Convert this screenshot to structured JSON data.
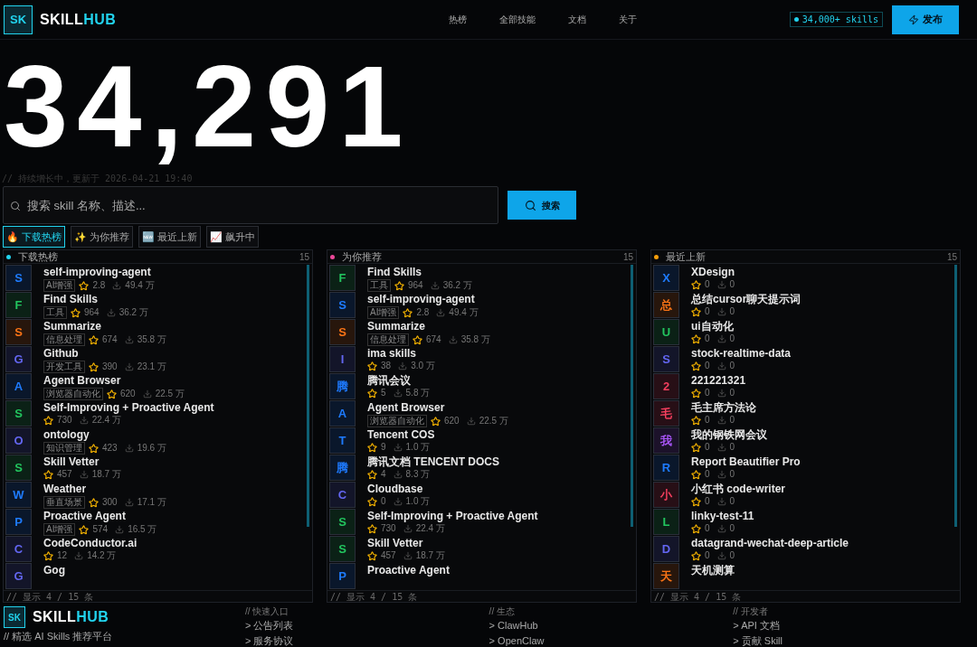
{
  "header": {
    "logo_mark": "SK",
    "logo_a": "SKILL",
    "logo_b": "HUB",
    "nav": [
      {
        "label": "热榜",
        "selected": false
      },
      {
        "label": "全部技能",
        "selected": false
      },
      {
        "label": "文档",
        "selected": false
      },
      {
        "label": "关于",
        "selected": false
      }
    ],
    "badge": "34,000+ skills",
    "publish": "发布"
  },
  "hero": {
    "number": "34,291",
    "subtitle": "// 持续增长中，更新于 2026-04-21 19:40"
  },
  "search": {
    "placeholder": "搜索 skill 名称、描述...",
    "button": "搜索"
  },
  "tabs": [
    {
      "icon": "🔥",
      "label": "下载热榜",
      "selected": true
    },
    {
      "icon": "✨",
      "label": "为你推荐",
      "selected": false
    },
    {
      "icon": "🆕",
      "label": "最近上新",
      "selected": false
    },
    {
      "icon": "📈",
      "label": "飙升中",
      "selected": false
    }
  ],
  "columns": [
    {
      "title": "下载热榜",
      "color": "#22d3ee",
      "count": "15",
      "footer": "// 显示 4 / 15 条",
      "items": [
        {
          "letter": "S",
          "color": "#1e7bff",
          "name": "self-improving-agent",
          "tag": "AI增强",
          "stars": "2.8",
          "downloads": "49.4 万"
        },
        {
          "letter": "F",
          "color": "#22c55e",
          "name": "Find Skills",
          "tag": "工具",
          "stars": "964",
          "downloads": "36.2 万"
        },
        {
          "letter": "S",
          "color": "#f97316",
          "name": "Summarize",
          "tag": "信息处理",
          "stars": "674",
          "downloads": "35.8 万"
        },
        {
          "letter": "G",
          "color": "#6366f1",
          "name": "Github",
          "tag": "开发工具",
          "stars": "390",
          "downloads": "23.1 万"
        },
        {
          "letter": "A",
          "color": "#1e7bff",
          "name": "Agent Browser",
          "tag": "浏览器自动化",
          "stars": "620",
          "downloads": "22.5 万"
        },
        {
          "letter": "S",
          "color": "#22c55e",
          "name": "Self-Improving + Proactive Agent",
          "stars": "730",
          "downloads": "22.4 万"
        },
        {
          "letter": "O",
          "color": "#6366f1",
          "name": "ontology",
          "tag": "知识管理",
          "stars": "423",
          "downloads": "19.6 万"
        },
        {
          "letter": "S",
          "color": "#22c55e",
          "name": "Skill Vetter",
          "stars": "457",
          "downloads": "18.7 万"
        },
        {
          "letter": "W",
          "color": "#1e7bff",
          "name": "Weather",
          "tag": "垂直场景",
          "stars": "300",
          "downloads": "17.1 万"
        },
        {
          "letter": "P",
          "color": "#1e7bff",
          "name": "Proactive Agent",
          "tag": "AI增强",
          "stars": "574",
          "downloads": "16.5 万"
        },
        {
          "letter": "C",
          "color": "#6366f1",
          "name": "CodeConductor.ai",
          "stars": "12",
          "downloads": "14.2 万"
        },
        {
          "letter": "G",
          "color": "#6366f1",
          "name": "Gog"
        }
      ]
    },
    {
      "title": "为你推荐",
      "color": "#ec4899",
      "count": "15",
      "footer": "// 显示 4 / 15 条",
      "items": [
        {
          "letter": "F",
          "color": "#22c55e",
          "name": "Find Skills",
          "tag": "工具",
          "stars": "964",
          "downloads": "36.2 万"
        },
        {
          "letter": "S",
          "color": "#1e7bff",
          "name": "self-improving-agent",
          "tag": "AI增强",
          "stars": "2.8",
          "downloads": "49.4 万"
        },
        {
          "letter": "S",
          "color": "#f97316",
          "name": "Summarize",
          "tag": "信息处理",
          "stars": "674",
          "downloads": "35.8 万"
        },
        {
          "letter": "I",
          "color": "#6366f1",
          "name": "ima skills",
          "stars": "38",
          "downloads": "3.0 万"
        },
        {
          "letter": "腾",
          "color": "#1e7bff",
          "name": "腾讯会议",
          "stars": "5",
          "downloads": "5.8 万"
        },
        {
          "letter": "A",
          "color": "#1e7bff",
          "name": "Agent Browser",
          "tag": "浏览器自动化",
          "stars": "620",
          "downloads": "22.5 万"
        },
        {
          "letter": "T",
          "color": "#1e7bff",
          "name": "Tencent COS",
          "stars": "9",
          "downloads": "1.0 万"
        },
        {
          "letter": "腾",
          "color": "#1e7bff",
          "name": "腾讯文档 TENCENT DOCS",
          "stars": "4",
          "downloads": "8.3 万"
        },
        {
          "letter": "C",
          "color": "#6366f1",
          "name": "Cloudbase",
          "stars": "0",
          "downloads": "1.0 万"
        },
        {
          "letter": "S",
          "color": "#22c55e",
          "name": "Self-Improving + Proactive Agent",
          "stars": "730",
          "downloads": "22.4 万"
        },
        {
          "letter": "S",
          "color": "#22c55e",
          "name": "Skill Vetter",
          "stars": "457",
          "downloads": "18.7 万"
        },
        {
          "letter": "P",
          "color": "#1e7bff",
          "name": "Proactive Agent"
        }
      ]
    },
    {
      "title": "最近上新",
      "color": "#f59e0b",
      "count": "15",
      "footer": "// 显示 4 / 15 条",
      "items": [
        {
          "letter": "X",
          "color": "#1e7bff",
          "name": "XDesign",
          "stars": "0",
          "downloads": "0"
        },
        {
          "letter": "总",
          "color": "#f97316",
          "name": "总结cursor聊天提示词",
          "stars": "0",
          "downloads": "0"
        },
        {
          "letter": "U",
          "color": "#22c55e",
          "name": "ui自动化",
          "stars": "0",
          "downloads": "0"
        },
        {
          "letter": "S",
          "color": "#6366f1",
          "name": "stock-realtime-data",
          "stars": "0",
          "downloads": "0"
        },
        {
          "letter": "2",
          "color": "#f43f5e",
          "name": "221221321",
          "stars": "0",
          "downloads": "0"
        },
        {
          "letter": "毛",
          "color": "#f43f5e",
          "name": "毛主席方法论",
          "stars": "0",
          "downloads": "0"
        },
        {
          "letter": "我",
          "color": "#a855f7",
          "name": "我的钢铁网会议",
          "stars": "0",
          "downloads": "0"
        },
        {
          "letter": "R",
          "color": "#1e7bff",
          "name": "Report Beautifier Pro",
          "stars": "0",
          "downloads": "0"
        },
        {
          "letter": "小",
          "color": "#f43f5e",
          "name": "小红书 code-writer",
          "stars": "0",
          "downloads": "0"
        },
        {
          "letter": "L",
          "color": "#22c55e",
          "name": "linky-test-11",
          "stars": "0",
          "downloads": "0"
        },
        {
          "letter": "D",
          "color": "#6366f1",
          "name": "datagrand-wechat-deep-article",
          "stars": "0",
          "downloads": "0"
        },
        {
          "letter": "天",
          "color": "#f97316",
          "name": "天机测算"
        }
      ]
    }
  ],
  "footer": {
    "logo_mark": "SK",
    "logo_a": "SKILL",
    "logo_b": "HUB",
    "tagline": "// 精选 AI Skills 推荐平台",
    "groups": [
      {
        "title": "// 快速入口",
        "links": [
          "> 公告列表",
          "> 服务协议"
        ]
      },
      {
        "title": "// 生态",
        "links": [
          "> ClawHub",
          "> OpenClaw"
        ]
      },
      {
        "title": "// 开发者",
        "links": [
          "> API 文档",
          "> 贡献 Skill"
        ]
      }
    ]
  }
}
